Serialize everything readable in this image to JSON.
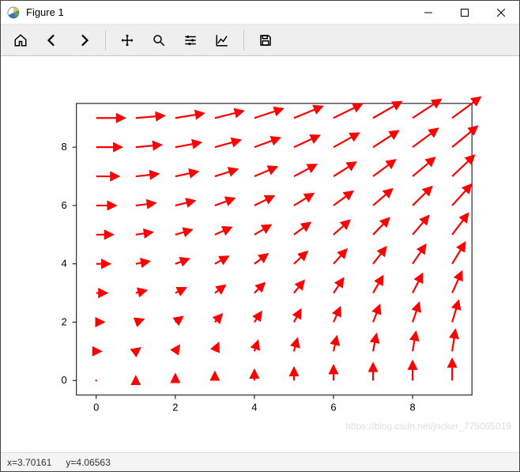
{
  "window": {
    "title": "Figure 1"
  },
  "toolbar": {
    "buttons": [
      {
        "name": "home-button",
        "icon": "home-icon"
      },
      {
        "name": "back-button",
        "icon": "arrow-left-icon"
      },
      {
        "name": "forward-button",
        "icon": "arrow-right-icon"
      },
      {
        "sep": true
      },
      {
        "name": "pan-button",
        "icon": "move-icon"
      },
      {
        "name": "zoom-button",
        "icon": "zoom-icon"
      },
      {
        "name": "configure-subplots-button",
        "icon": "sliders-icon"
      },
      {
        "name": "edit-axes-button",
        "icon": "chart-icon"
      },
      {
        "sep": true
      },
      {
        "name": "save-button",
        "icon": "save-icon"
      }
    ]
  },
  "status": {
    "x_label": "x=3.70161",
    "y_label": "y=4.06563"
  },
  "watermark": "https://blog.csdn.net/jocker_775065019",
  "chart_data": {
    "type": "quiver",
    "title": "",
    "xlabel": "",
    "ylabel": "",
    "xlim": [
      -0.5,
      9.5
    ],
    "ylim": [
      -0.5,
      9.5
    ],
    "xticks": [
      0,
      2,
      4,
      6,
      8
    ],
    "yticks": [
      0,
      2,
      4,
      6,
      8
    ],
    "arrow_color": "#ff0000",
    "grid_x": [
      0,
      1,
      2,
      3,
      4,
      5,
      6,
      7,
      8,
      9
    ],
    "grid_y": [
      0,
      1,
      2,
      3,
      4,
      5,
      6,
      7,
      8,
      9
    ],
    "u_formula": "y",
    "v_formula": "x",
    "description": "10x10 quiver grid. At point (i,j) the vector has components (u,v) = (j, i) — horizontal magnitude equals y-index, vertical magnitude equals x-index. Arrow length scaled by ~0.07 data-units per unit magnitude."
  }
}
